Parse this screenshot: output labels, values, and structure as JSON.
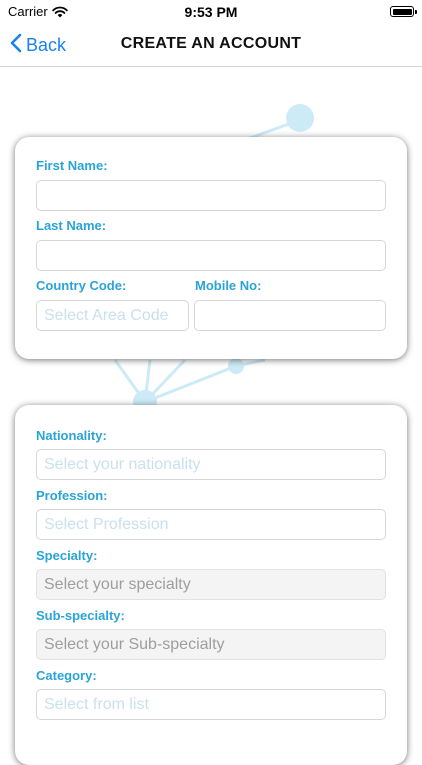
{
  "status_bar": {
    "carrier": "Carrier",
    "time": "9:53 PM"
  },
  "nav": {
    "back_label": "Back",
    "title": "CREATE AN ACCOUNT"
  },
  "card1": {
    "first_name_label": "First Name:",
    "first_name_value": "",
    "last_name_label": "Last Name:",
    "last_name_value": "",
    "country_code_label": "Country Code:",
    "country_code_placeholder": "Select Area Code",
    "mobile_label": "Mobile No:",
    "mobile_value": ""
  },
  "card2": {
    "nationality_label": "Nationality:",
    "nationality_placeholder": "Select your nationality",
    "profession_label": "Profession:",
    "profession_placeholder": "Select Profession",
    "specialty_label": "Specialty:",
    "specialty_placeholder": "Select your specialty",
    "subspecialty_label": "Sub-specialty:",
    "subspecialty_placeholder": "Select your Sub-specialty",
    "category_label": "Category:",
    "category_placeholder": "Select from list"
  },
  "colors": {
    "accent": "#1a82f0",
    "label": "#2aa4d6",
    "network": "#bfe3f4"
  },
  "icons": {
    "back": "chevron-left-icon",
    "wifi": "wifi-icon",
    "battery": "battery-icon"
  }
}
